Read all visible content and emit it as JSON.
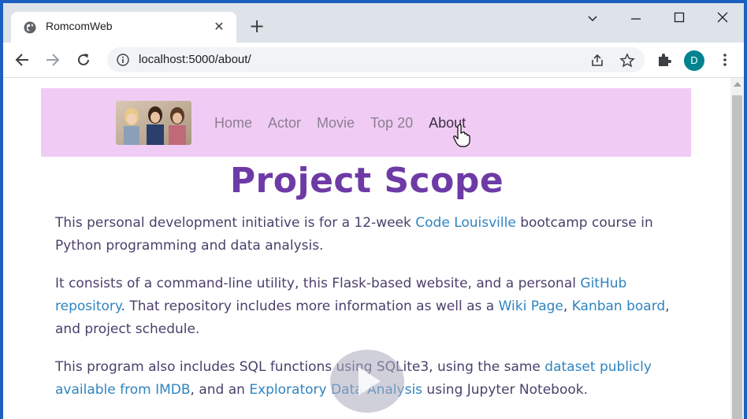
{
  "browser": {
    "tab_title": "RomcomWeb",
    "url": "localhost:5000/about/",
    "profile_initial": "D"
  },
  "nav": {
    "links": [
      "Home",
      "Actor",
      "Movie",
      "Top 20",
      "About"
    ],
    "active": "About"
  },
  "page": {
    "title": "Project Scope",
    "p1": {
      "t1": "This personal development initiative is for a 12-week ",
      "link1": "Code Louisville",
      "t2": " bootcamp course in Python programming and data analysis."
    },
    "p2": {
      "t1": "It consists of a command-line utility, this Flask-based website, and a personal ",
      "link1": "GitHub repository",
      "t2": ". That repository includes more information as well as a ",
      "link2": "Wiki Page",
      "t3": ", ",
      "link3": "Kanban board",
      "t4": ", and project schedule."
    },
    "p3": {
      "t1": "This program also includes SQL functions using SQLite3, using the same ",
      "link1": "dataset publicly available from IMDB",
      "t2": ", and an ",
      "link2": "Exploratory Data Analysis",
      "t3": " using Jupyter Notebook."
    }
  },
  "colors": {
    "navbar_bg": "#f0ccf5",
    "title": "#6d3aa6",
    "body_text": "#4b3f6b",
    "link": "#2f84c0"
  }
}
